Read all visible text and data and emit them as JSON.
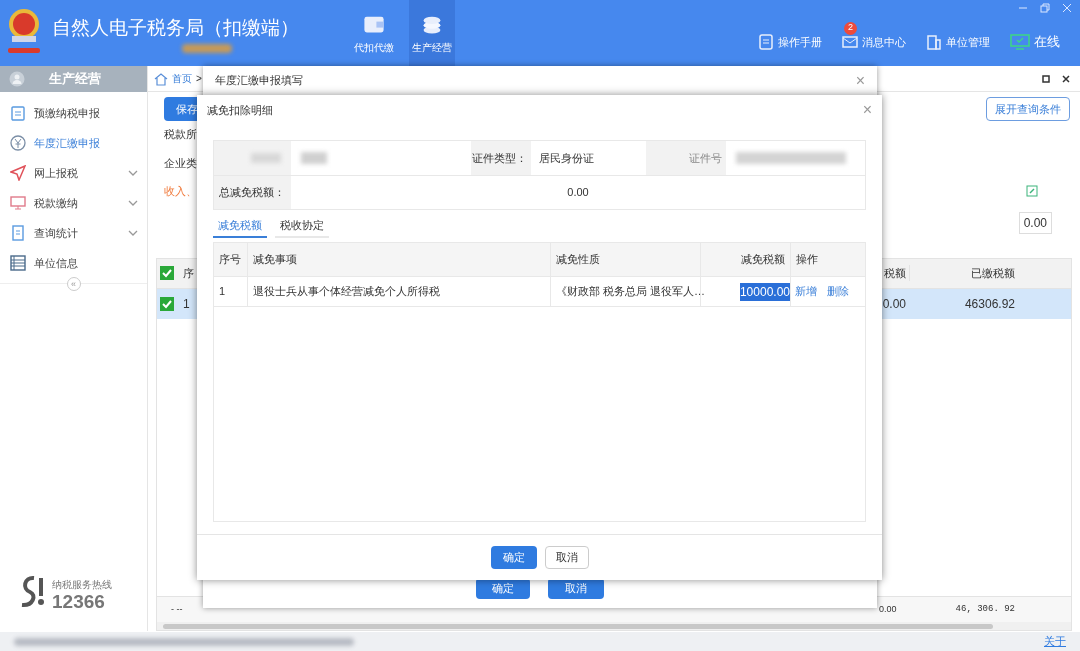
{
  "header": {
    "title": "自然人电子税务局（扣缴端）",
    "nav": [
      {
        "label": "代扣代缴",
        "selected": false,
        "kind": "wallet"
      },
      {
        "label": "生产经营",
        "selected": true,
        "kind": "coins"
      }
    ],
    "tools": [
      {
        "label": "操作手册",
        "kind": "manual"
      },
      {
        "label": "消息中心",
        "kind": "mail",
        "badge": "2"
      },
      {
        "label": "单位管理",
        "kind": "building"
      },
      {
        "label": "在线",
        "kind": "online"
      }
    ]
  },
  "sidebar": {
    "title": "生产经营",
    "items": [
      {
        "label": "预缴纳税申报",
        "kind": "clipboard",
        "selected": false,
        "expandable": false
      },
      {
        "label": "年度汇缴申报",
        "kind": "yen",
        "selected": true,
        "expandable": false
      },
      {
        "label": "网上报税",
        "kind": "send",
        "selected": false,
        "expandable": true
      },
      {
        "label": "税款缴纳",
        "kind": "monitor",
        "selected": false,
        "expandable": true
      },
      {
        "label": "查询统计",
        "kind": "doc",
        "selected": false,
        "expandable": true
      },
      {
        "label": "单位信息",
        "kind": "list",
        "selected": false,
        "expandable": false
      }
    ],
    "collapse": "«",
    "hotline_label": "纳税服务热线",
    "hotline_number": "12366"
  },
  "main": {
    "breadcrumb_home": "首页",
    "breadcrumb_sep": ">",
    "save_button": "保存",
    "expand_button": "展开查询条件",
    "labels": [
      "税款所",
      "企业类"
    ],
    "warning": "收入、",
    "field_value": "0.00",
    "table": {
      "columns": [
        "序",
        "税额",
        "已缴税额"
      ],
      "rows": [
        {
          "selected": true,
          "checked": true,
          "cells": [
            "1",
            "0.00",
            "46306.92"
          ]
        }
      ],
      "header_checked": true,
      "total": [
        "- --",
        "0.00",
        "46, 306. 92"
      ]
    },
    "footer_link": "关于"
  },
  "dialog_outer": {
    "title": "年度汇缴申报填写",
    "close": "×",
    "buttons": [
      "确定",
      "取消"
    ]
  },
  "dialog": {
    "title": "减免扣除明细",
    "close": "×",
    "id_type_label": "证件类型：",
    "id_type": "居民身份证",
    "id_no_label": "证件号",
    "total_label": "总减免税额：",
    "total": "0.00",
    "tabs": [
      {
        "label": "减免税额",
        "selected": true
      },
      {
        "label": "税收协定",
        "selected": false
      }
    ],
    "table": {
      "columns": [
        "序号",
        "减免事项",
        "减免性质",
        "减免税额",
        "操作"
      ],
      "rows": [
        {
          "cells": [
            "1",
            "退役士兵从事个体经营减免个人所得税",
            "《财政部 税务总局 退役军人…",
            "10000.00"
          ],
          "amount_highlighted": true,
          "actions": [
            "新增",
            "删除"
          ]
        }
      ]
    },
    "buttons": [
      "确定",
      "取消"
    ]
  }
}
